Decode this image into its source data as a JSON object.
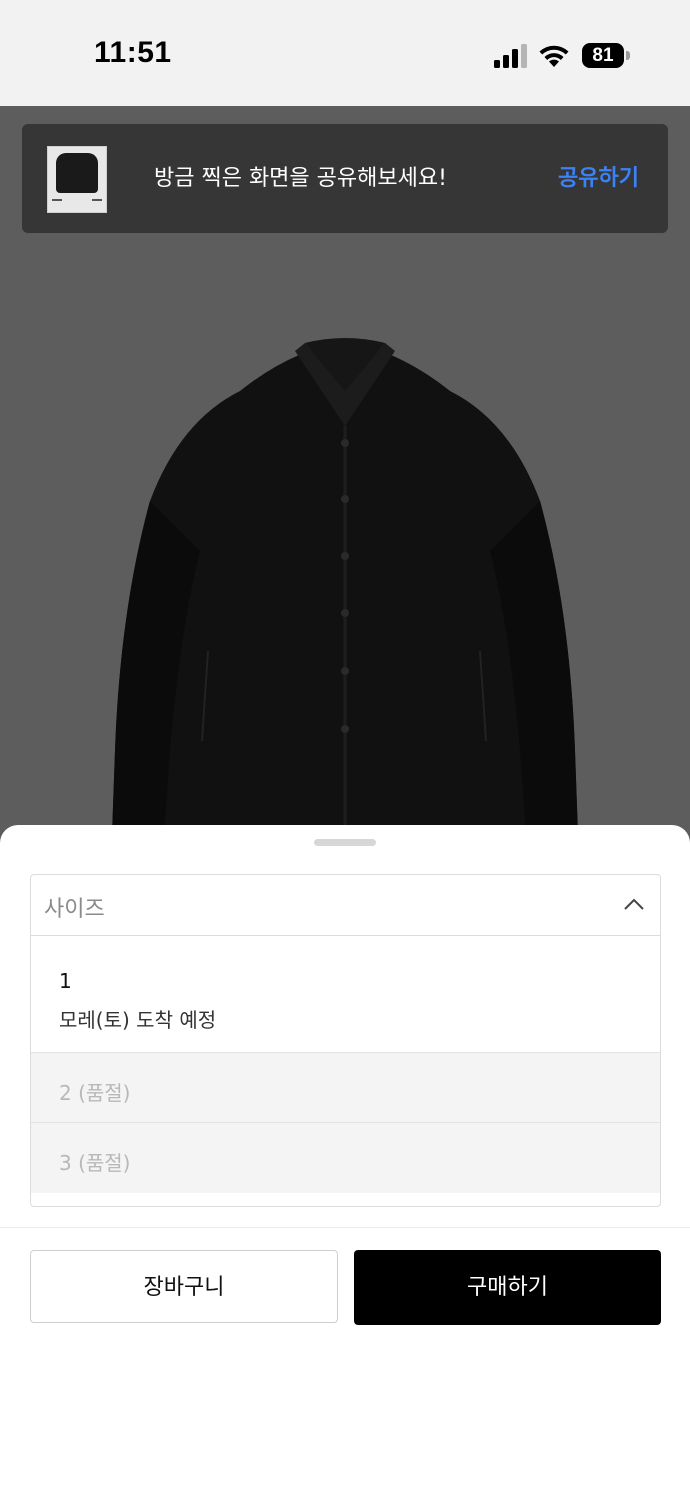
{
  "status_bar": {
    "time": "11:51",
    "battery": "81",
    "icons": [
      "signal-icon",
      "wifi-icon",
      "battery-icon"
    ]
  },
  "share_toast": {
    "message": "방금 찍은 화면을 공유해보세요!",
    "action_label": "공유하기",
    "action_color": "#3b82f6"
  },
  "product": {
    "image": "black-shirt-product-photo"
  },
  "size_select": {
    "label": "사이즈",
    "options": [
      {
        "label": "1",
        "note": "모레(토) 도착 예정",
        "available": true
      },
      {
        "label": "2 (품절)",
        "available": false
      },
      {
        "label": "3 (품절)",
        "available": false
      }
    ]
  },
  "actions": {
    "cart_label": "장바구니",
    "buy_label": "구매하기"
  }
}
